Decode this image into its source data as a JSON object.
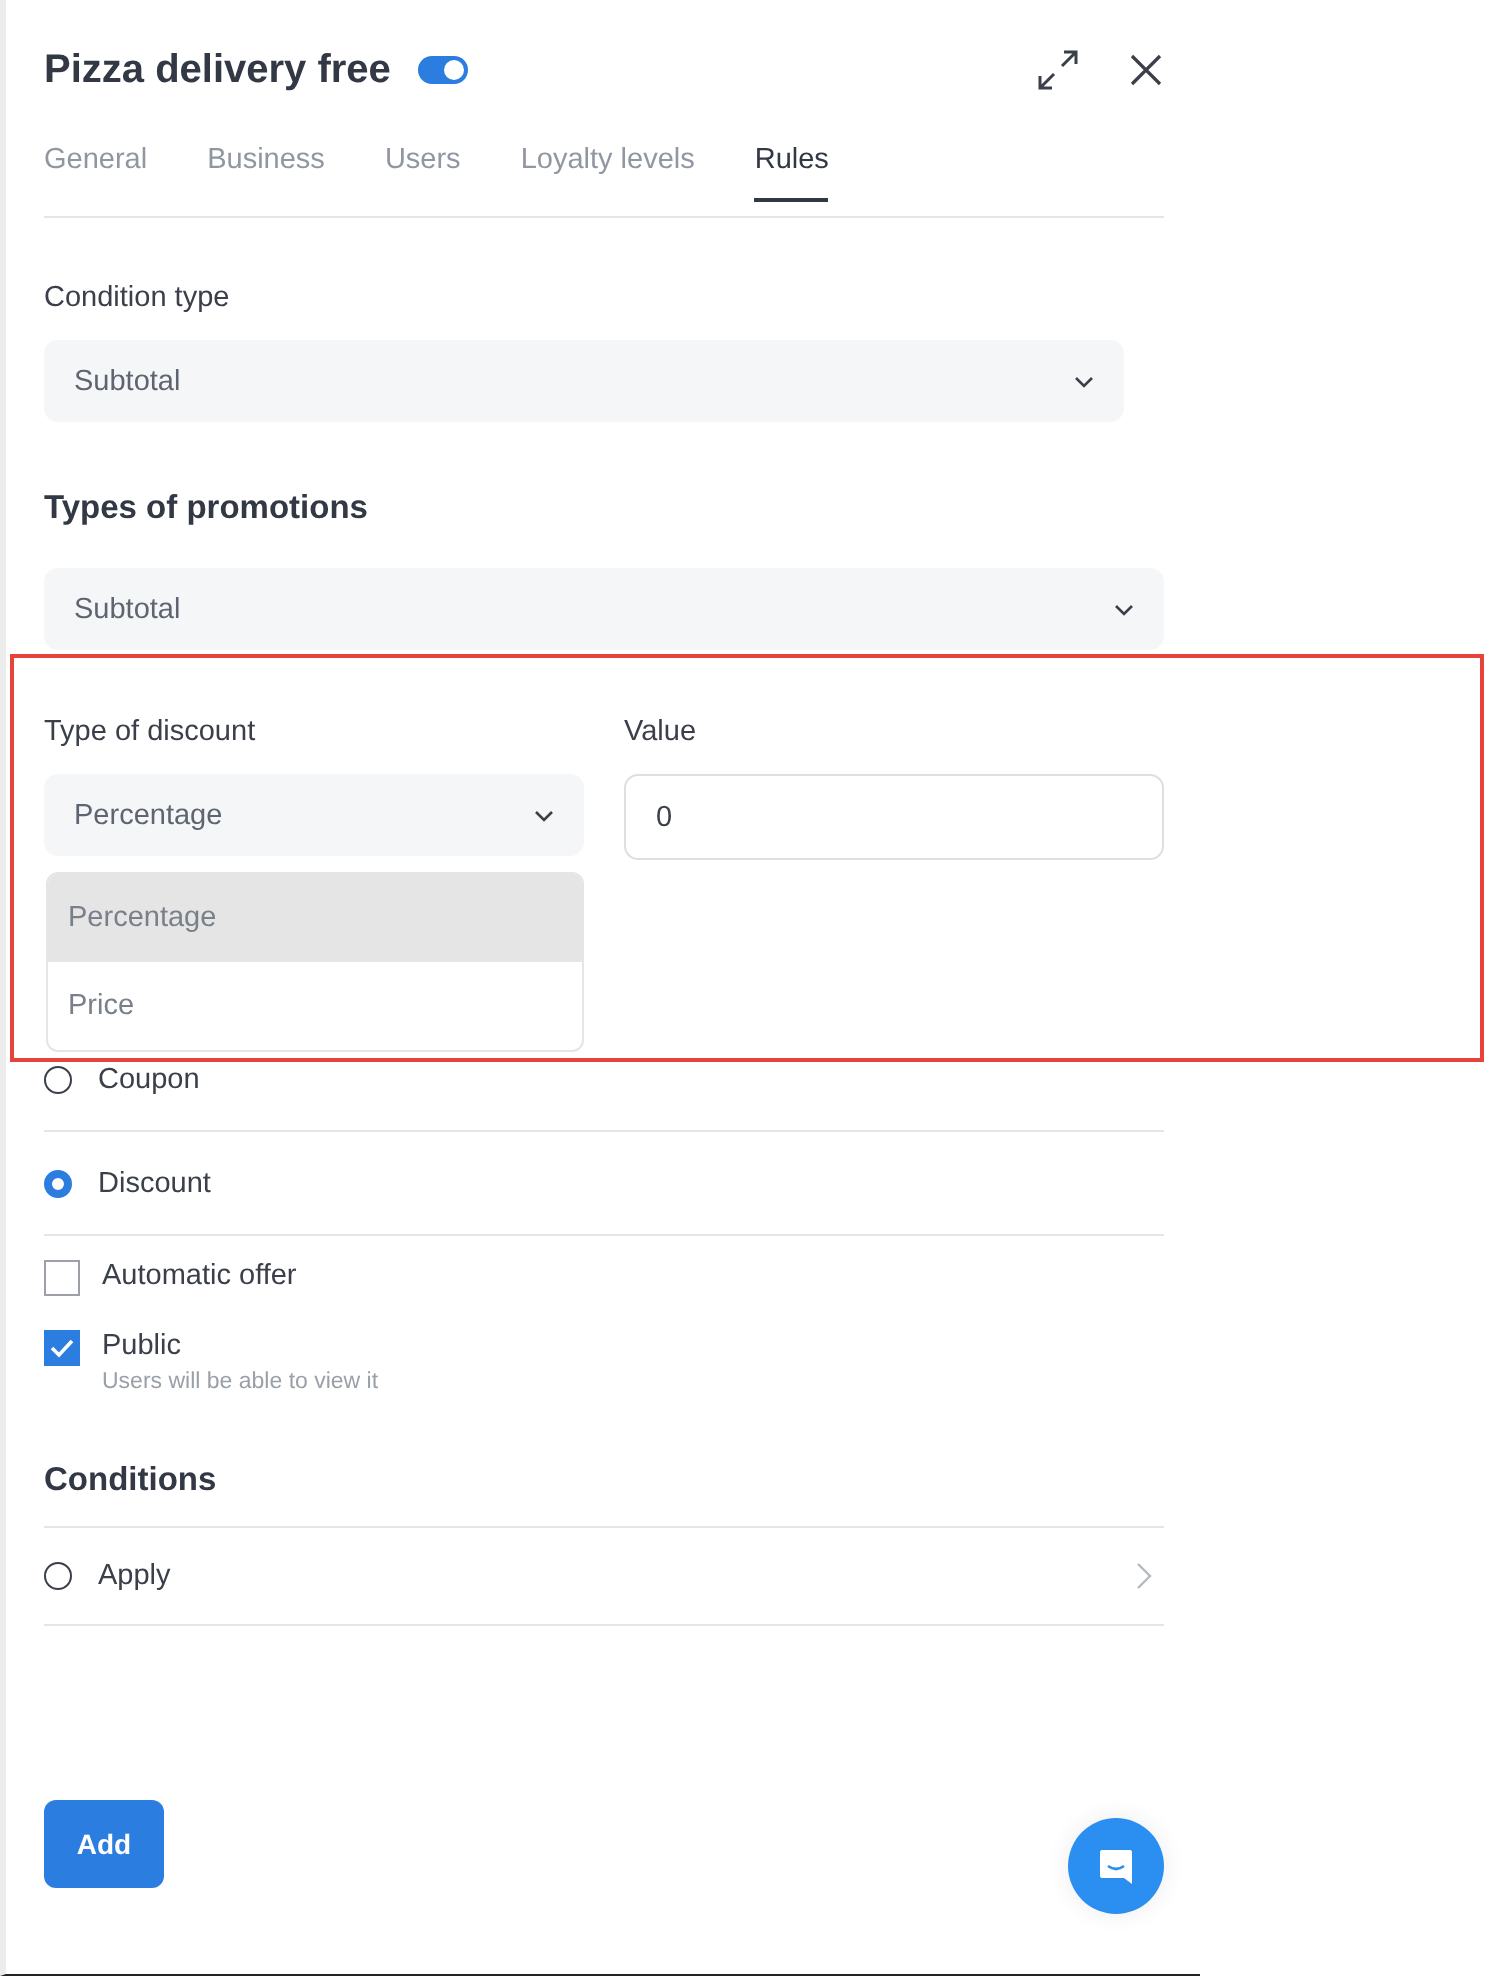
{
  "header": {
    "title": "Pizza delivery free",
    "enabled": true
  },
  "tabs": [
    {
      "label": "General",
      "selected": false
    },
    {
      "label": "Business",
      "selected": false
    },
    {
      "label": "Users",
      "selected": false
    },
    {
      "label": "Loyalty levels",
      "selected": false
    },
    {
      "label": "Rules",
      "selected": true
    }
  ],
  "condition_type": {
    "label": "Condition type",
    "value": "Subtotal"
  },
  "promotions": {
    "heading": "Types of promotions",
    "value": "Subtotal"
  },
  "discount": {
    "label": "Type of discount",
    "value": "Percentage",
    "expanded": true,
    "options": [
      {
        "label": "Percentage",
        "selected": true
      },
      {
        "label": "Price",
        "selected": false
      }
    ]
  },
  "value_field": {
    "label": "Value",
    "value": "0"
  },
  "offer_types": [
    {
      "label": "Coupon",
      "selected": false
    },
    {
      "label": "Discount",
      "selected": true
    }
  ],
  "options": [
    {
      "label": "Automatic offer",
      "checked": false
    },
    {
      "label": "Public",
      "checked": true,
      "hint": "Users will be able to view it"
    }
  ],
  "conditions": {
    "heading": "Conditions",
    "items": [
      {
        "label": "Apply",
        "selected": false
      }
    ]
  },
  "add_button": "Add"
}
